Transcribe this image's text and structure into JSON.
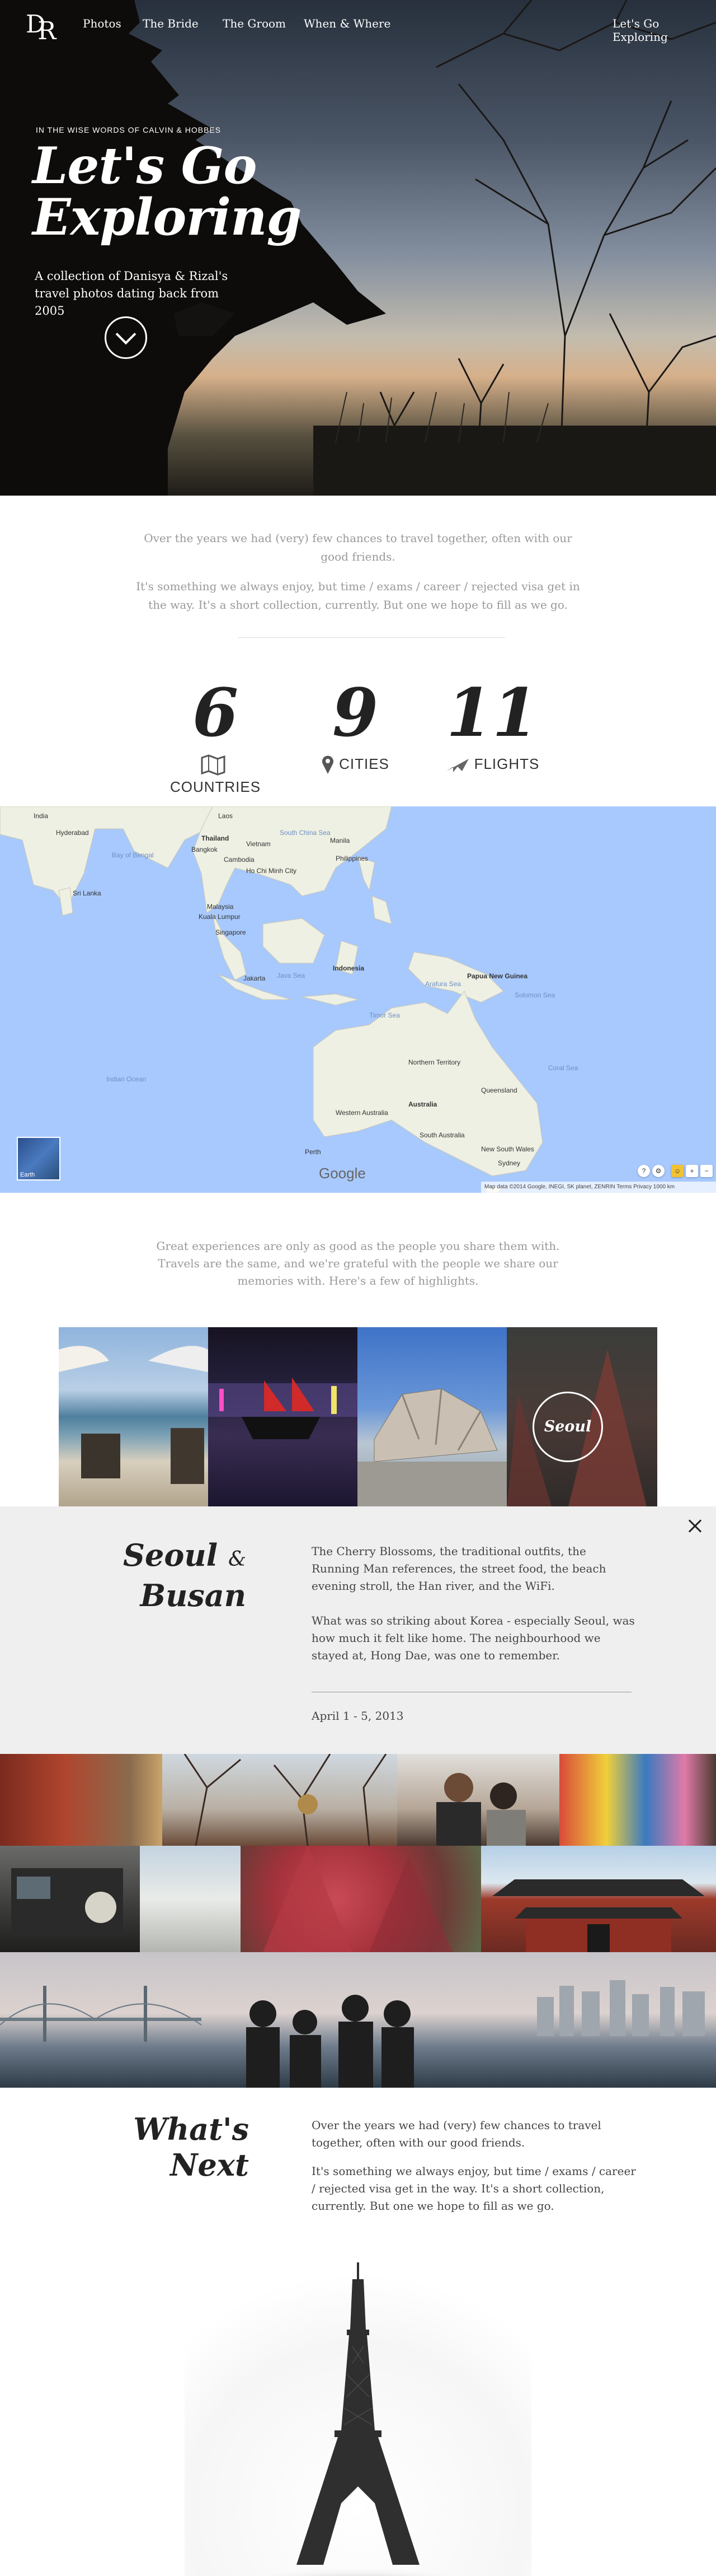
{
  "nav": {
    "logo": [
      "D",
      "R"
    ],
    "items": [
      "Photos",
      "The Bride",
      "The Groom",
      "When & Where"
    ],
    "right_link": "Let's Go Exploring"
  },
  "hero": {
    "kicker": "IN THE WISE WORDS OF CALVIN & HOBBES",
    "title_line1": "Let's Go",
    "title_line2": "Exploring",
    "subtitle": "A collection of Danisya & Rizal's travel photos dating back from 2005",
    "scroll_icon": "chevron-down-icon"
  },
  "intro": {
    "p1": "Over the years we had (very) few chances to travel together, often with our good friends.",
    "p2": "It's something we always enjoy, but time / exams / career / rejected visa get in the way. It's a short collection, currently. But one we hope to fill as we go."
  },
  "stats": [
    {
      "value": "6",
      "label": "COUNTRIES",
      "icon": "map-icon"
    },
    {
      "value": "9",
      "label": "CITIES",
      "icon": "location-pin-icon"
    },
    {
      "value": "11",
      "label": "FLIGHTS",
      "icon": "airplane-icon"
    }
  ],
  "map": {
    "labels": {
      "india_label": "India",
      "hyderabad": "Hyderabad",
      "bay": "Bay of Bengal",
      "sri_lanka": "Sri Lanka",
      "laos": "Laos",
      "thailand": "Thailand",
      "bangkok": "Bangkok",
      "vietnam": "Vietnam",
      "cambodia": "Cambodia",
      "hcm": "Ho Chi Minh City",
      "philippines": "Philippines",
      "manila": "Manila",
      "scs": "South China Sea",
      "malaysia": "Malaysia",
      "kl": "Kuala Lumpur",
      "singapore": "Singapore",
      "indonesia": "Indonesia",
      "jakarta": "Jakarta",
      "java": "Java Sea",
      "png": "Papua New Guinea",
      "timor": "Timor Sea",
      "coral": "Coral Sea",
      "arafura": "Arafura Sea",
      "australia": "Australia",
      "nt": "Northern Territory",
      "wa": "Western Australia",
      "qld": "Queensland",
      "sa": "South Australia",
      "nsw": "New South Wales",
      "perth": "Perth",
      "sydney": "Sydney",
      "indian_ocean": "Indian Ocean",
      "solomon": "Solomon Sea"
    },
    "thumb_label": "Earth",
    "logo": "Google",
    "footer": "Map data ©2014 Google, INEGI, SK planet, ZENRIN   Terms   Privacy   1000 km"
  },
  "highlights": {
    "intro": "Great experiences are only as good as the people you share them with. Travels are the same, and we're grateful with the people we share our memories with. Here's a few of highlights.",
    "seoul_label": "Seoul"
  },
  "detail": {
    "title_line1": "Seoul",
    "amp": "&",
    "title_line2": "Busan",
    "p1": "The Cherry Blossoms, the traditional outfits, the Running Man references, the street food, the beach evening stroll, the Han river, and the WiFi.",
    "p2": "What was so striking about Korea - especially Seoul, was how much it felt like home. The neighbourhood we stayed at, Hong Dae,  was one to remember.",
    "date": "April 1 - 5, 2013",
    "close_icon": "close-icon"
  },
  "next": {
    "title_line1": "What's",
    "title_line2": "Next",
    "p1": "Over the years we had (very) few chances to travel together, often with our good friends.",
    "p2": "It's something we always enjoy, but time / exams / career / rejected visa get in the way. It's a short collection, currently. But one we hope to fill as we go."
  }
}
